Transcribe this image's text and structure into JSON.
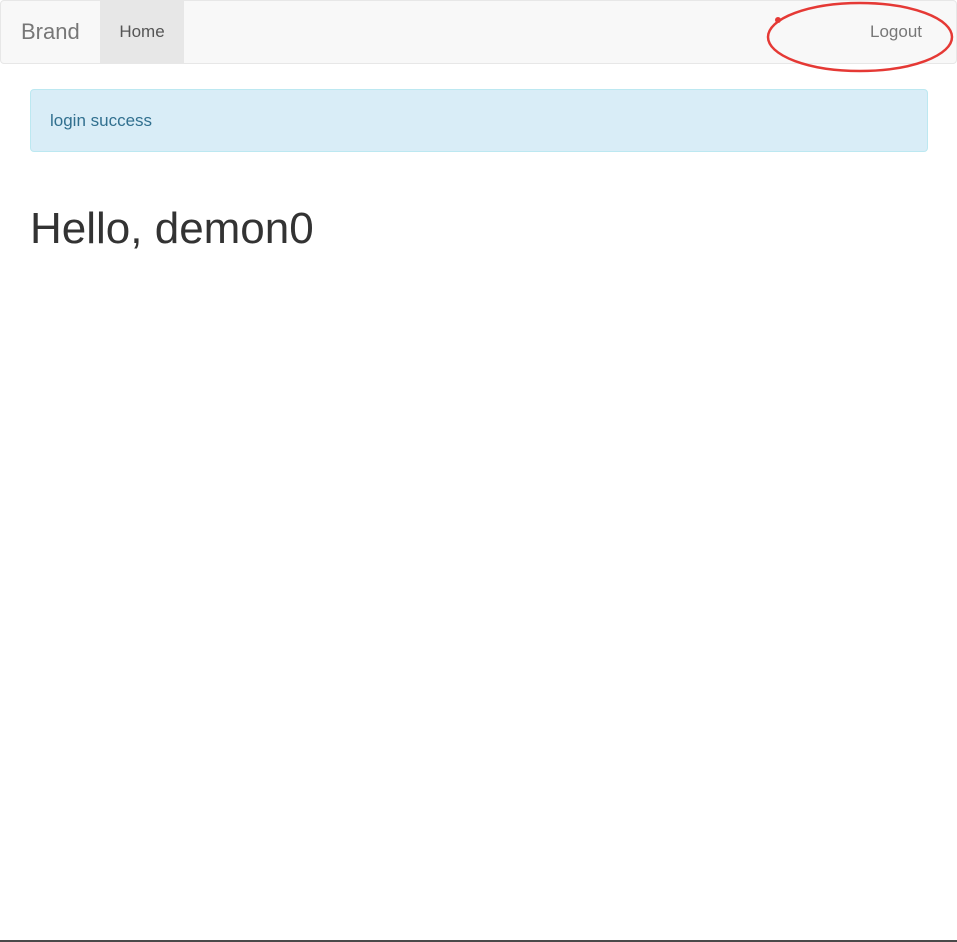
{
  "navbar": {
    "brand": "Brand",
    "items": [
      {
        "label": "Home",
        "active": true
      }
    ],
    "logout_label": "Logout"
  },
  "alert": {
    "message": "login success",
    "type": "info"
  },
  "main": {
    "greeting": "Hello, demon0"
  },
  "colors": {
    "navbar_bg": "#f8f8f8",
    "active_tab_bg": "#e7e7e7",
    "alert_bg": "#d9edf7",
    "alert_text": "#31708f",
    "annotation": "#e53935"
  }
}
